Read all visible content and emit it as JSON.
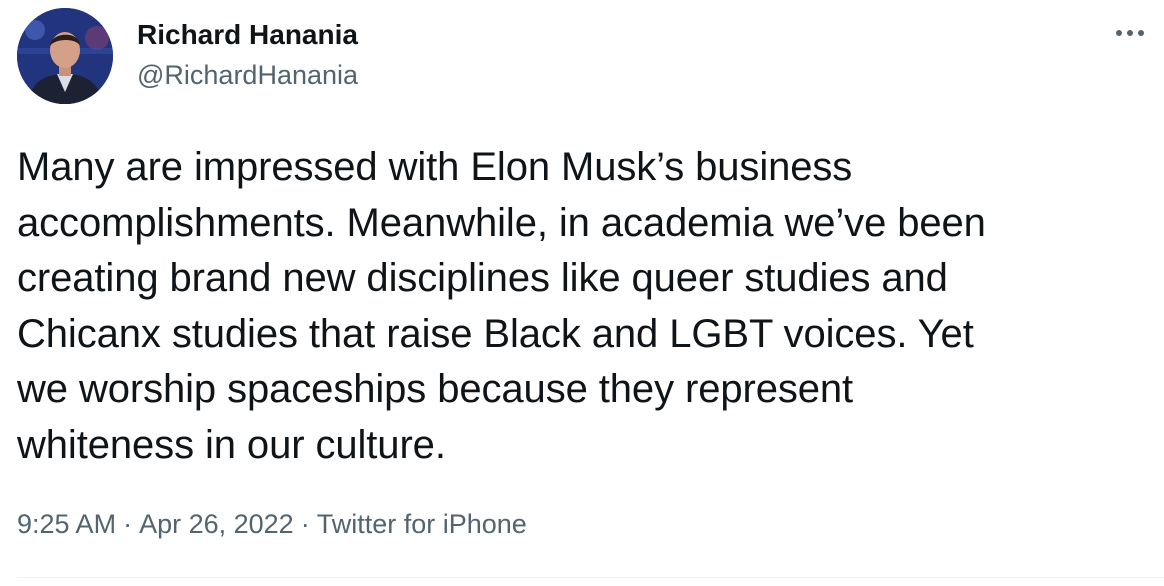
{
  "author": {
    "name": "Richard Hanania",
    "handle": "@RichardHanania",
    "avatar_icon": "profile-photo"
  },
  "more_icon": "more-horizontal-icon",
  "tweet": {
    "text": "Many are impressed with Elon Musk’s business\naccomplishments. Meanwhile, in academia we’ve been\ncreating brand new disciplines like queer studies and\nChicanx studies that raise Black and LGBT voices. Yet\nwe worship spaceships because they represent\nwhiteness in our culture."
  },
  "meta": {
    "time": "9:25 AM",
    "separator": "·",
    "date": "Apr 26, 2022",
    "source": "Twitter for iPhone"
  },
  "colors": {
    "text_primary": "#0f1419",
    "text_secondary": "#536471",
    "divider": "#eff3f4"
  }
}
